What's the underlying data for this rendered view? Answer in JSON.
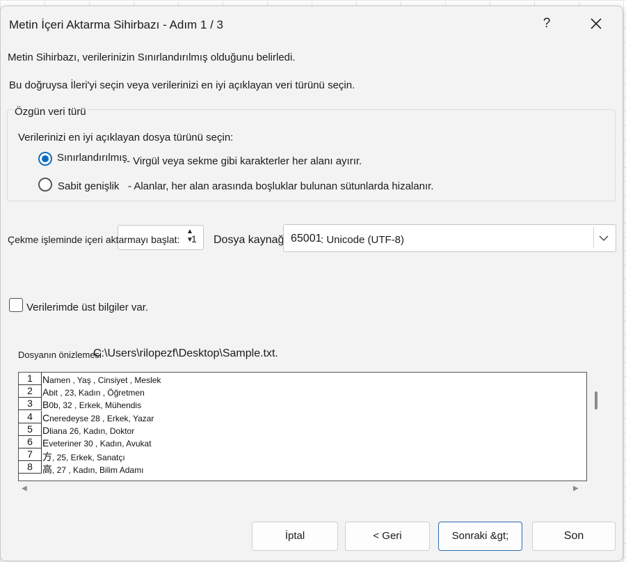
{
  "window": {
    "title": "Metin İçeri Aktarma Sihirbazı - Adım 1 / 3",
    "help_label": "?"
  },
  "intro": {
    "line1": "Metin Sihirbazı, verilerinizin Sınırlandırılmış olduğunu belirledi.",
    "line2": "Bu doğruysa İleri'yi seçin veya verilerinizi en iyi açıklayan veri türünü seçin."
  },
  "original_type": {
    "legend": "Özgün veri türü",
    "prompt": "Verilerinizi en iyi açıklayan dosya türünü seçin:",
    "options": [
      {
        "label": "Sınırlandırılmış",
        "description": "- Virgül veya sekme gibi karakterler her alanı ayırır.",
        "selected": true
      },
      {
        "label": "Sabit genişlik",
        "description": "- Alanlar, her alan arasında boşluklar bulunan sütunlarda hizalanır.",
        "selected": false
      }
    ]
  },
  "start_row": {
    "label": "Çekme işleminde içeri aktarmayı başlat:",
    "value": "1"
  },
  "file_origin": {
    "label": "Dosya kaynağı",
    "code": "65001",
    "value": " : Unicode (UTF-8)"
  },
  "headers_checkbox": {
    "label": "Verilerimde üst bilgiler var.",
    "checked": false
  },
  "preview": {
    "label": "Dosyanın önizlemesi",
    "path": "C:\\Users\\rilopezf\\Desktop\\Sample.txt.",
    "rows": [
      {
        "num": "1",
        "lead": "N",
        "text": "amen , Yaş , Cinsiyet , Meslek"
      },
      {
        "num": "2",
        "lead": "A",
        "text": "bit , 23, Kadın , Öğretmen"
      },
      {
        "num": "3",
        "lead": "B",
        "text": "0b, 32 , Erkek, Mühendis"
      },
      {
        "num": "4",
        "lead": "C",
        "text": "neredeyse 28 , Erkek, Yazar"
      },
      {
        "num": "5",
        "lead": "D",
        "text": "liana 26, Kadın, Doktor"
      },
      {
        "num": "6",
        "lead": "E",
        "text": "veteriner 30 , Kadın, Avukat"
      },
      {
        "num": "7",
        "lead": "方",
        "text": ", 25, Erkek, Sanatçı"
      },
      {
        "num": "8",
        "lead": "高",
        "text": ", 27 , Kadın, Bilim Adamı"
      }
    ]
  },
  "buttons": {
    "cancel": "İptal",
    "back": "< Geri",
    "next": "Sonraki &gt;",
    "finish": "Son"
  },
  "colors": {
    "accent": "#0f6cbd",
    "dialog_bg": "#f3f3f3"
  }
}
